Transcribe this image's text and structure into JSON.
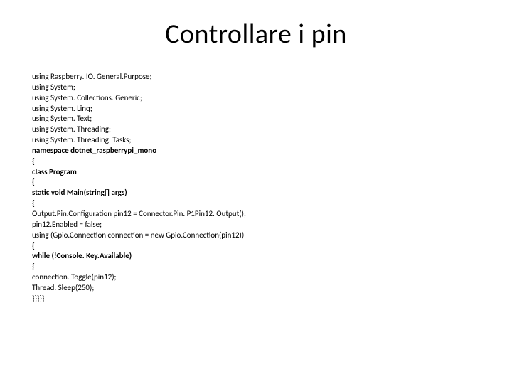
{
  "title": "Controllare i pin",
  "lines": [
    {
      "text": "using Raspberry. IO. General.Purpose;",
      "bold": false
    },
    {
      "text": "using System;",
      "bold": false
    },
    {
      "text": "using System. Collections. Generic;",
      "bold": false
    },
    {
      "text": "using System. Linq;",
      "bold": false
    },
    {
      "text": "using System. Text;",
      "bold": false
    },
    {
      "text": "using System. Threading;",
      "bold": false
    },
    {
      "text": "using System. Threading. Tasks;",
      "bold": false
    },
    {
      "text": "namespace dotnet_raspberrypi_mono",
      "bold": true
    },
    {
      "text": "{",
      "bold": true
    },
    {
      "text": "class Program",
      "bold": true
    },
    {
      "text": "{",
      "bold": true
    },
    {
      "text": "static void Main(string[] args)",
      "bold": true
    },
    {
      "text": "{",
      "bold": true
    },
    {
      "text": "Output.Pin.Configuration pin12 = Connector.Pin. P1Pin12. Output();",
      "bold": false
    },
    {
      "text": "pin12.Enabled = false;",
      "bold": false
    },
    {
      "text": "using (Gpio.Connection connection = new Gpio.Connection(pin12))",
      "bold": false
    },
    {
      "text": "{",
      "bold": true
    },
    {
      "text": "while (!Console. Key.Available)",
      "bold": true
    },
    {
      "text": "{",
      "bold": true
    },
    {
      "text": "connection. Toggle(pin12);",
      "bold": false
    },
    {
      "text": "Thread. Sleep(250);",
      "bold": false
    },
    {
      "text": "}}}}}",
      "bold": false
    }
  ]
}
